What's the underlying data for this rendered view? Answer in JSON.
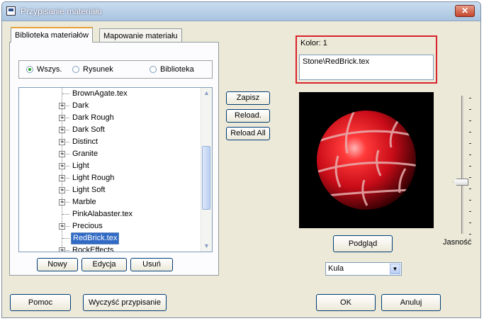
{
  "window": {
    "title": "Przypisanie materiału",
    "close_label": "✕"
  },
  "tabs": [
    {
      "label": "Biblioteka materiałów",
      "active": true
    },
    {
      "label": "Mapowanie materiału",
      "active": false
    }
  ],
  "filter": {
    "options": [
      {
        "label": "Wszys.",
        "selected": true
      },
      {
        "label": "Rysunek",
        "selected": false
      },
      {
        "label": "Biblioteka",
        "selected": false
      }
    ]
  },
  "tree": {
    "items": [
      {
        "label": "BrownAgate.tex",
        "expandable": false,
        "selected": false
      },
      {
        "label": "Dark",
        "expandable": true,
        "selected": false
      },
      {
        "label": "Dark Rough",
        "expandable": true,
        "selected": false
      },
      {
        "label": "Dark Soft",
        "expandable": true,
        "selected": false
      },
      {
        "label": "Distinct",
        "expandable": true,
        "selected": false
      },
      {
        "label": "Granite",
        "expandable": true,
        "selected": false
      },
      {
        "label": "Light",
        "expandable": true,
        "selected": false
      },
      {
        "label": "Light Rough",
        "expandable": true,
        "selected": false
      },
      {
        "label": "Light Soft",
        "expandable": true,
        "selected": false
      },
      {
        "label": "Marble",
        "expandable": true,
        "selected": false
      },
      {
        "label": "PinkAlabaster.tex",
        "expandable": false,
        "selected": false
      },
      {
        "label": "Precious",
        "expandable": true,
        "selected": false
      },
      {
        "label": "RedBrick.tex",
        "expandable": false,
        "selected": true
      },
      {
        "label": "RockEffects",
        "expandable": true,
        "selected": false
      }
    ],
    "expand_glyph": "+"
  },
  "library_buttons": {
    "save": "Zapisz",
    "reload": "Reload.",
    "reload_all": "Reload All"
  },
  "tab_buttons": {
    "new": "Nowy",
    "edit": "Edycja",
    "delete": "Usuń"
  },
  "material": {
    "color_label": "Kolor: 1",
    "path": "Stone\\RedBrick.tex"
  },
  "preview": {
    "button": "Podgląd",
    "shape": "Kula",
    "sphere_color": "#d4121f",
    "brightness_label": "Jasność"
  },
  "footer": {
    "help": "Pomoc",
    "clear": "Wyczyść przypisanie",
    "ok": "OK",
    "cancel": "Anuluj"
  }
}
